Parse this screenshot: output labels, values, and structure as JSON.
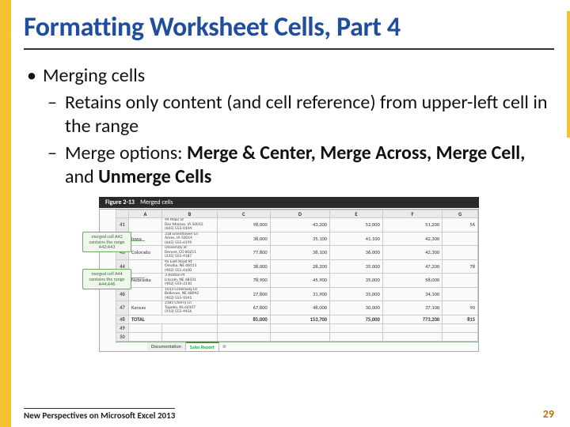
{
  "title": "Formatting Worksheet Cells, Part 4",
  "bullets": {
    "l1": "Merging cells",
    "l2a": "Retains only content (and cell reference) from upper-left cell in the range",
    "l2b_pre": "Merge options: ",
    "l2b_b1": "Merge & Center, Merge Across, Merge Cell, ",
    "l2b_mid": "and ",
    "l2b_b2": "Unmerge Cells"
  },
  "figure": {
    "caption_label": "Figure 2-13",
    "caption_text": "Merged cells",
    "callout1": "merged cell A42 contains the range A42:A43",
    "callout2": "merged cell A44 contains the range A44:A46",
    "cols": [
      "",
      "A",
      "B",
      "C",
      "D",
      "E",
      "F",
      "G"
    ],
    "rows": [
      {
        "n": "41",
        "state": "",
        "addr": "44 Main St\nDes Moines, IA 50012\n(665) 555-0104",
        "c": "98,000",
        "d": "43,200",
        "e": "52,000",
        "f": "51,200",
        "g": "56"
      },
      {
        "n": "42",
        "state": "Iowa",
        "addr": "318 Eisenhower Ln\nAmes, IA 50014\n(665) 555-6199",
        "c": "38,000",
        "d": "35,100",
        "e": "41,100",
        "f": "42,300",
        "g": ""
      },
      {
        "n": "43",
        "state": "Colorado",
        "addr": "University St\nDenver, CO 80211\n(335) 555-4187",
        "c": "77,800",
        "d": "38,100",
        "e": "36,000",
        "f": "42,300",
        "g": ""
      },
      {
        "n": "44",
        "state": "",
        "addr": "45 East Road Rt\nOmaha, NE 68111\n(402) 555-6100",
        "c": "38,000",
        "d": "28,200",
        "e": "35,000",
        "f": "47,200",
        "g": "78"
      },
      {
        "n": "45",
        "state": "Nebraska",
        "addr": "3 Ashton Pl\nLincoln, NE 68501\n(402) 555-3110",
        "c": "78,900",
        "d": "45,900",
        "e": "35,000",
        "f": "58,000",
        "g": ""
      },
      {
        "n": "46",
        "state": "",
        "addr": "1613 Greenway Dr\nBellevue, NE 68042\n(402) 555-9341",
        "c": "27,800",
        "d": "31,900",
        "e": "35,000",
        "f": "34,100",
        "g": ""
      },
      {
        "n": "47",
        "state": "Kansas",
        "addr": "2181 Cherry Ln\nTopeka, KS 62107\n(913) 555-4456",
        "c": "67,800",
        "d": "48,000",
        "e": "30,000",
        "f": "37,100",
        "g": "90"
      }
    ],
    "total": {
      "n": "48",
      "label": "TOTAL",
      "c": "85,000",
      "d": "153,700",
      "e": "75,000",
      "f": "773,200",
      "g": "815"
    },
    "blank_rows": [
      "49",
      "50"
    ],
    "tabs": {
      "t1": "Documentation",
      "t2": "Sales Report",
      "plus": "⊕"
    }
  },
  "footer": {
    "text": "New Perspectives on Microsoft Excel 2013",
    "page": "29"
  }
}
